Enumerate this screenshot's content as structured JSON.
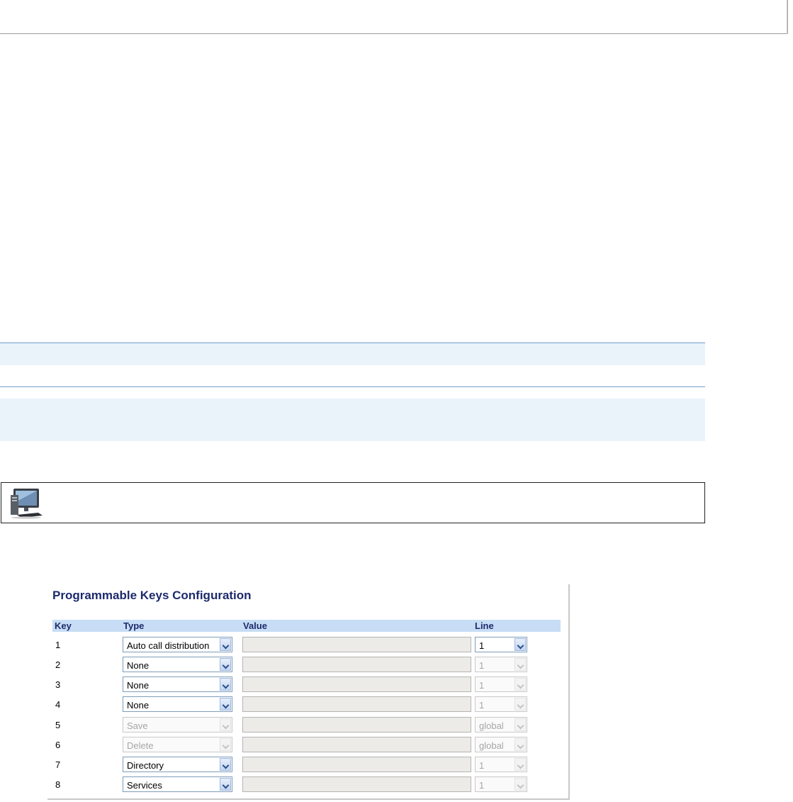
{
  "panel": {
    "title": "Programmable Keys Configuration",
    "columns": {
      "key": "Key",
      "type": "Type",
      "value": "Value",
      "line": "Line"
    },
    "rows": [
      {
        "key": "1",
        "type": "Auto call distribution",
        "type_enabled": true,
        "value": "",
        "line": "1",
        "line_enabled": true
      },
      {
        "key": "2",
        "type": "None",
        "type_enabled": true,
        "value": "",
        "line": "1",
        "line_enabled": false
      },
      {
        "key": "3",
        "type": "None",
        "type_enabled": true,
        "value": "",
        "line": "1",
        "line_enabled": false
      },
      {
        "key": "4",
        "type": "None",
        "type_enabled": true,
        "value": "",
        "line": "1",
        "line_enabled": false
      },
      {
        "key": "5",
        "type": "Save",
        "type_enabled": false,
        "value": "",
        "line": "global",
        "line_enabled": false
      },
      {
        "key": "6",
        "type": "Delete",
        "type_enabled": false,
        "value": "",
        "line": "global",
        "line_enabled": false
      },
      {
        "key": "7",
        "type": "Directory",
        "type_enabled": true,
        "value": "",
        "line": "1",
        "line_enabled": false
      },
      {
        "key": "8",
        "type": "Services",
        "type_enabled": true,
        "value": "",
        "line": "1",
        "line_enabled": false
      }
    ]
  },
  "note": {
    "icon": "computer-workstation-icon"
  },
  "colors": {
    "title": "#1d2a6b",
    "header_bg": "#c7ddf5",
    "band_bg": "#eaf2fa",
    "band_rule": "#6f9fcf"
  }
}
